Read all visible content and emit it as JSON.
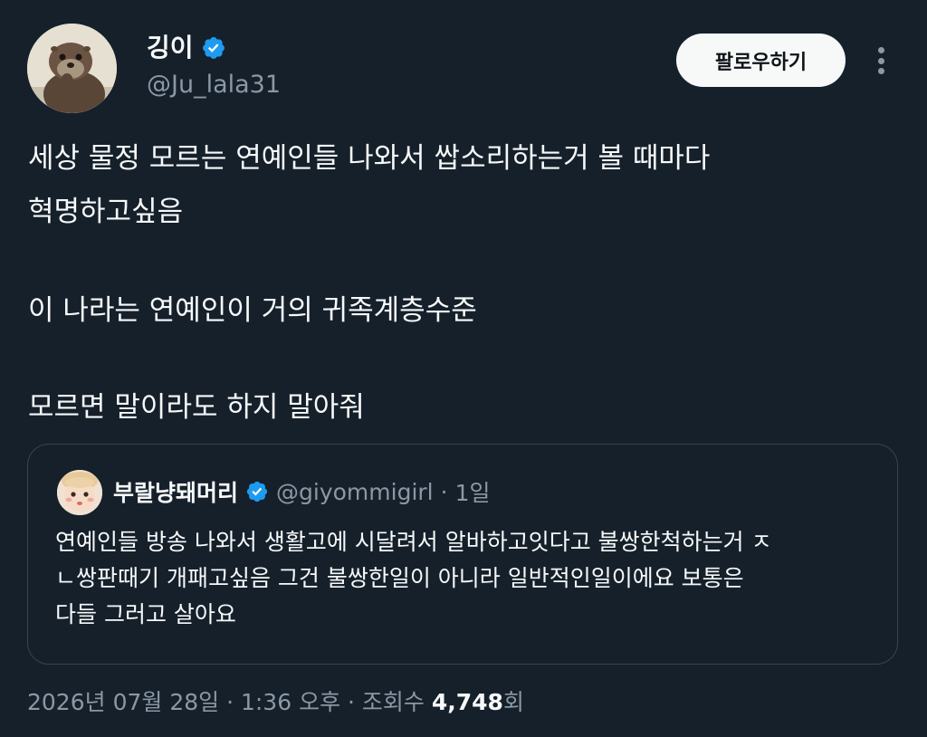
{
  "author": {
    "display_name": "깅이",
    "handle": "@Ju_lala31",
    "verified": true,
    "avatar_icon": "otter-avatar-icon"
  },
  "follow_button": {
    "label": "팔로우하기"
  },
  "more_menu": {
    "icon": "more-options-icon"
  },
  "tweet": {
    "lines": [
      "세상 물정 모르는 연예인들 나와서 쌉소리하는거 볼 때마다",
      "혁명하고싶음",
      "이 나라는 연예인이 거의 귀족계층수준",
      "모르면 말이라도 하지 말아줘"
    ]
  },
  "quoted": {
    "display_name": "부랄냥돼머리",
    "handle": "@giyommigirl",
    "separator": "·",
    "time": "1일",
    "verified": true,
    "avatar_icon": "doll-face-avatar-icon",
    "lines": [
      "연예인들 방송 나와서 생활고에 시달려서 알바하고잇다고 불쌍한척하는거 ㅈ",
      "ㄴ쌍판때기 개패고싶음 그건 불쌍한일이 아니라 일반적인일이에요 보통은",
      "다들 그러고 살아요"
    ]
  },
  "meta": {
    "date_time": "2026년 07월 28일 · 1:36 오후 · 조회수 ",
    "views": "4,748",
    "views_suffix": "회"
  },
  "colors": {
    "background": "#15202b",
    "text_primary": "#f7f9f9",
    "text_secondary": "#8b98a5",
    "verified_blue": "#1d9bf0",
    "border": "#38444d"
  }
}
